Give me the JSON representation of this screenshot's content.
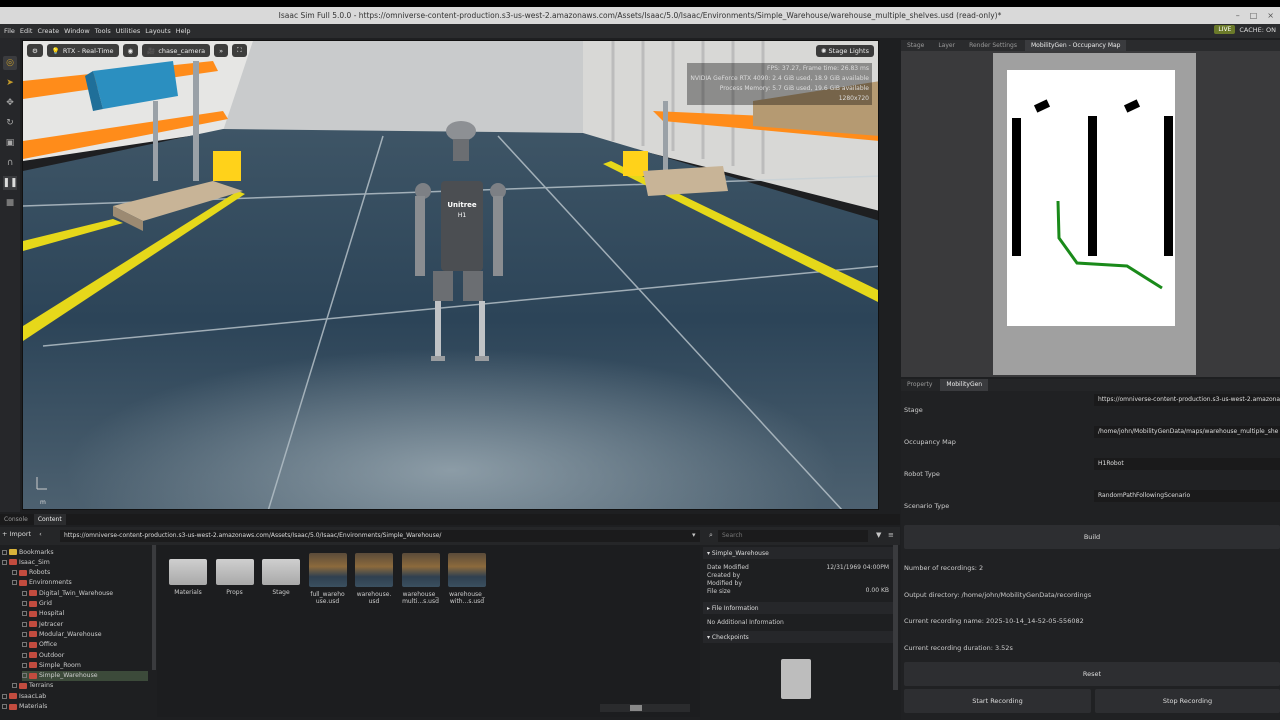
{
  "window": {
    "title": "Isaac Sim Full 5.0.0 - https://omniverse-content-production.s3-us-west-2.amazonaws.com/Assets/Isaac/5.0/Isaac/Environments/Simple_Warehouse/warehouse_multiple_shelves.usd (read-only)*"
  },
  "menu": {
    "items": [
      "File",
      "Edit",
      "Create",
      "Window",
      "Tools",
      "Utilities",
      "Layouts",
      "Help"
    ],
    "live": "LIVE",
    "cache": "CACHE: ON"
  },
  "viewport": {
    "renderer": "RTX - Real-Time",
    "camera": "chase_camera",
    "stage_lights": "Stage Lights",
    "stats": [
      "FPS: 37.27, Frame time: 26.83 ms",
      "NVIDIA GeForce RTX 4090: 2.4 GiB used, 18.9 GiB available",
      "Process Memory: 5.7 GiB used, 19.6 GiB available",
      "1280x720"
    ],
    "robot_brand": "Unitree",
    "robot_model": "H1",
    "axis_label": "m"
  },
  "right_tabs": [
    "Stage",
    "Layer",
    "Render Settings",
    "MobilityGen - Occupancy Map"
  ],
  "mobilitygen": {
    "tabs": [
      "Property",
      "MobilityGen"
    ],
    "stage_label": "Stage",
    "stage_value": "https://omniverse-content-production.s3-us-west-2.amazonaws",
    "occ_label": "Occupancy Map",
    "occ_value": "/home/john/MobilityGenData/maps/warehouse_multiple_she",
    "robot_label": "Robot Type",
    "robot_value": "H1Robot",
    "scenario_label": "Scenario Type",
    "scenario_value": "RandomPathFollowingScenario",
    "build": "Build",
    "num_recordings": "Number of recordings: 2",
    "output_dir": "Output directory: /home/john/MobilityGenData/recordings",
    "current_name": "Current recording name: 2025-10-14_14-52-05-556082",
    "current_duration": "Current recording duration: 3.52s",
    "reset": "Reset",
    "start": "Start Recording",
    "stop": "Stop Recording"
  },
  "content": {
    "tabs": [
      "Console",
      "Content"
    ],
    "import": "Import",
    "path": "https://omniverse-content-production.s3-us-west-2.amazonaws.com/Assets/Isaac/5.0/Isaac/Environments/Simple_Warehouse/",
    "search_placeholder": "Search",
    "tree": [
      {
        "label": "Bookmarks",
        "indent": 1
      },
      {
        "label": "Isaac_Sim",
        "indent": 1
      },
      {
        "label": "Robots",
        "indent": 2
      },
      {
        "label": "Environments",
        "indent": 2
      },
      {
        "label": "Digital_Twin_Warehouse",
        "indent": 3
      },
      {
        "label": "Grid",
        "indent": 3
      },
      {
        "label": "Hospital",
        "indent": 3
      },
      {
        "label": "Jetracer",
        "indent": 3
      },
      {
        "label": "Modular_Warehouse",
        "indent": 3
      },
      {
        "label": "Office",
        "indent": 3
      },
      {
        "label": "Outdoor",
        "indent": 3
      },
      {
        "label": "Simple_Room",
        "indent": 3
      },
      {
        "label": "Simple_Warehouse",
        "indent": 3
      },
      {
        "label": "Terrains",
        "indent": 2
      },
      {
        "label": "IsaacLab",
        "indent": 1
      },
      {
        "label": "Materials",
        "indent": 1
      }
    ],
    "files": [
      {
        "label": "Materials",
        "kind": "folder"
      },
      {
        "label": "Props",
        "kind": "folder"
      },
      {
        "label": "Stage",
        "kind": "folder"
      },
      {
        "label": "full_wareho use.usd",
        "kind": "usd"
      },
      {
        "label": "warehouse. usd",
        "kind": "usd"
      },
      {
        "label": "warehouse_ multi...s.usd",
        "kind": "usd"
      },
      {
        "label": "warehouse_ with...s.usd",
        "kind": "usd"
      }
    ],
    "info": {
      "folder": "Simple_Warehouse",
      "date_modified_label": "Date Modified",
      "date_modified": "12/31/1969 04:00PM",
      "created_by": "Created by",
      "modified_by": "Modified by",
      "file_size_label": "File size",
      "file_size": "0.00 KB",
      "file_info": "File Information",
      "no_info": "No Additional Information",
      "checkpoints": "Checkpoints"
    }
  }
}
